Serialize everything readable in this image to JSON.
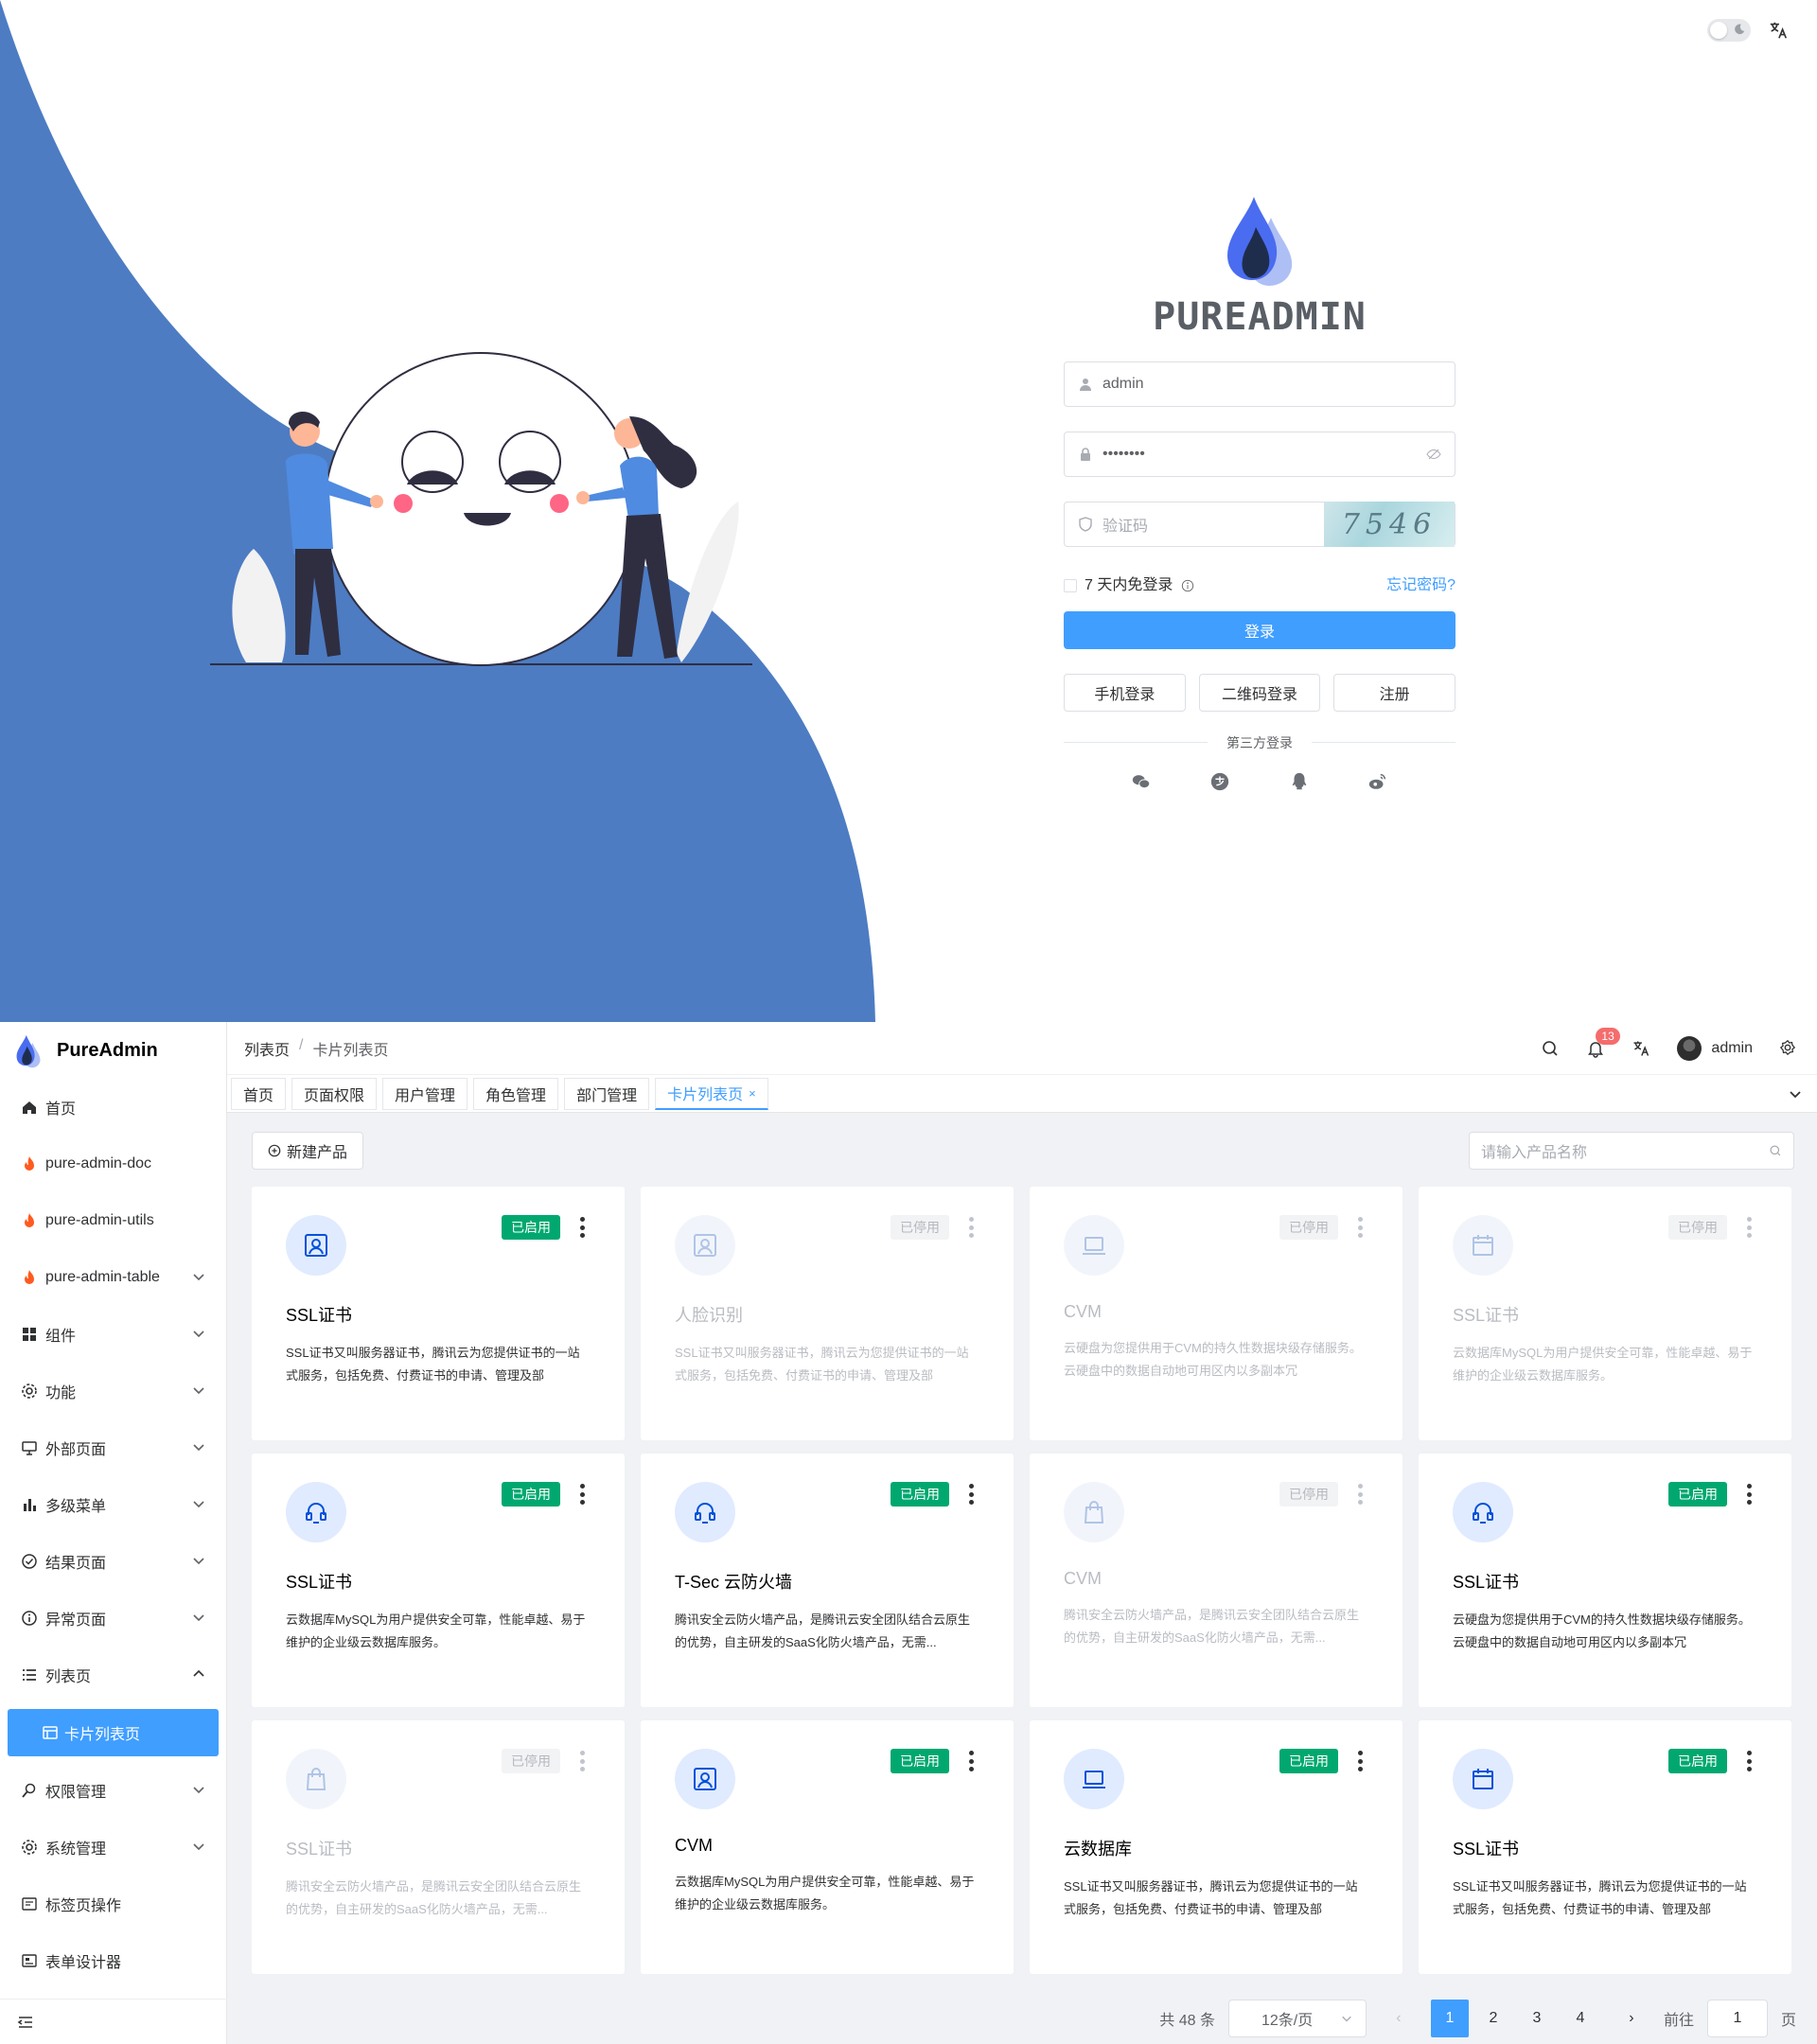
{
  "login": {
    "brand": "PUREADMIN",
    "username_value": "admin",
    "password_value": "••••••••",
    "captcha_placeholder": "验证码",
    "captcha_code": "7546",
    "remember_label": "7 天内免登录",
    "forgot_label": "忘记密码?",
    "login_button": "登录",
    "alt_buttons": [
      "手机登录",
      "二维码登录",
      "注册"
    ],
    "third_party_label": "第三方登录",
    "social_icons": [
      "wechat-icon",
      "alipay-icon",
      "qq-icon",
      "weibo-icon"
    ],
    "colors": {
      "primary": "#409eff",
      "wave": "#4d7cc3"
    }
  },
  "admin": {
    "app_title": "PureAdmin",
    "sidebar": {
      "items": [
        {
          "label": "首页",
          "icon": "home-icon",
          "chevron": false
        },
        {
          "label": "pure-admin-doc",
          "icon": "fire-icon",
          "chevron": false
        },
        {
          "label": "pure-admin-utils",
          "icon": "fire-icon",
          "chevron": false
        },
        {
          "label": "pure-admin-table",
          "icon": "fire-icon",
          "chevron": true
        },
        {
          "label": "组件",
          "icon": "grid-icon",
          "chevron": true
        },
        {
          "label": "功能",
          "icon": "settings-icon",
          "chevron": true
        },
        {
          "label": "外部页面",
          "icon": "monitor-icon",
          "chevron": true
        },
        {
          "label": "多级菜单",
          "icon": "bar-chart-icon",
          "chevron": true
        },
        {
          "label": "结果页面",
          "icon": "check-circle-icon",
          "chevron": true
        },
        {
          "label": "异常页面",
          "icon": "info-circle-icon",
          "chevron": true
        },
        {
          "label": "列表页",
          "icon": "list-icon",
          "chevron": "up"
        }
      ],
      "active_item": "卡片列表页",
      "items_after": [
        {
          "label": "权限管理",
          "icon": "lock-search-icon",
          "chevron": true
        },
        {
          "label": "系统管理",
          "icon": "settings-icon",
          "chevron": true
        },
        {
          "label": "标签页操作",
          "icon": "tag-icon",
          "chevron": false
        },
        {
          "label": "表单设计器",
          "icon": "form-icon",
          "chevron": false
        }
      ]
    },
    "breadcrumb": [
      "列表页",
      "卡片列表页"
    ],
    "header": {
      "notification_count": "13",
      "user_name": "admin"
    },
    "tabs": [
      "首页",
      "页面权限",
      "用户管理",
      "角色管理",
      "部门管理",
      "卡片列表页"
    ],
    "active_tab": "卡片列表页",
    "new_product_label": "新建产品",
    "search_placeholder": "请输入产品名称",
    "status_on": "已启用",
    "status_off": "已停用",
    "cards": [
      {
        "title": "SSL证书",
        "desc": "SSL证书又叫服务器证书，腾讯云为您提供证书的一站式服务，包括免费、付费证书的申请、管理及部",
        "icon": "user-id-icon",
        "enabled": true
      },
      {
        "title": "人脸识别",
        "desc": "SSL证书又叫服务器证书，腾讯云为您提供证书的一站式服务，包括免费、付费证书的申请、管理及部",
        "icon": "user-id-icon",
        "enabled": false
      },
      {
        "title": "CVM",
        "desc": "云硬盘为您提供用于CVM的持久性数据块级存储服务。云硬盘中的数据自动地可用区内以多副本冗",
        "icon": "laptop-icon",
        "enabled": false
      },
      {
        "title": "SSL证书",
        "desc": "云数据库MySQL为用户提供安全可靠，性能卓越、易于维护的企业级云数据库服务。",
        "icon": "calendar-icon",
        "enabled": false
      },
      {
        "title": "SSL证书",
        "desc": "云数据库MySQL为用户提供安全可靠，性能卓越、易于维护的企业级云数据库服务。",
        "icon": "headset-icon",
        "enabled": true
      },
      {
        "title": "T-Sec 云防火墙",
        "desc": "腾讯安全云防火墙产品，是腾讯云安全团队结合云原生的优势，自主研发的SaaS化防火墙产品，无需...",
        "icon": "headset-icon",
        "enabled": true
      },
      {
        "title": "CVM",
        "desc": "腾讯安全云防火墙产品，是腾讯云安全团队结合云原生的优势，自主研发的SaaS化防火墙产品，无需...",
        "icon": "shop-icon",
        "enabled": false
      },
      {
        "title": "SSL证书",
        "desc": "云硬盘为您提供用于CVM的持久性数据块级存储服务。云硬盘中的数据自动地可用区内以多副本冗",
        "icon": "headset-icon",
        "enabled": true
      },
      {
        "title": "SSL证书",
        "desc": "腾讯安全云防火墙产品，是腾讯云安全团队结合云原生的优势，自主研发的SaaS化防火墙产品，无需...",
        "icon": "shop-icon",
        "enabled": false
      },
      {
        "title": "CVM",
        "desc": "云数据库MySQL为用户提供安全可靠，性能卓越、易于维护的企业级云数据库服务。",
        "icon": "user-id-icon",
        "enabled": true
      },
      {
        "title": "云数据库",
        "desc": "SSL证书又叫服务器证书，腾讯云为您提供证书的一站式服务，包括免费、付费证书的申请、管理及部",
        "icon": "laptop-icon",
        "enabled": true
      },
      {
        "title": "SSL证书",
        "desc": "SSL证书又叫服务器证书，腾讯云为您提供证书的一站式服务，包括免费、付费证书的申请、管理及部",
        "icon": "calendar-icon",
        "enabled": true
      }
    ],
    "pagination": {
      "total_label": "共 48 条",
      "page_size_label": "12条/页",
      "pages": [
        "1",
        "2",
        "3",
        "4"
      ],
      "current_page": "1",
      "goto_label": "前往",
      "goto_value": "1",
      "page_unit": "页"
    }
  }
}
